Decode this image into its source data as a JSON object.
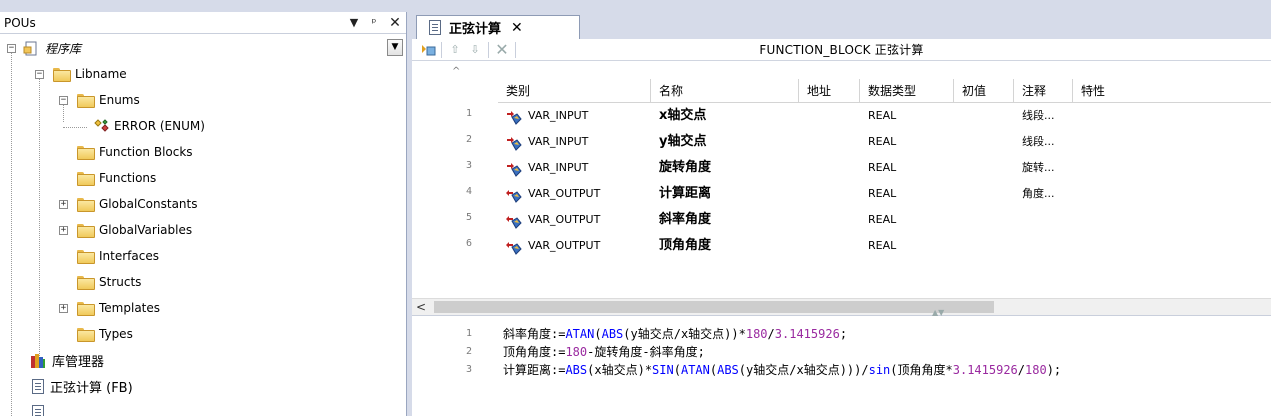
{
  "pou_panel": {
    "title": "POUs",
    "pin_glyph": "▾",
    "dock_glyph": "ꟷ",
    "close_glyph": "✕",
    "tree": [
      {
        "label": "程序库",
        "italic": true,
        "icon": "project-icon"
      },
      {
        "label": "Libname",
        "icon": "folder-icon"
      },
      {
        "label": "Enums",
        "icon": "folder-icon"
      },
      {
        "label": "ERROR (ENUM)",
        "icon": "enum-icon"
      },
      {
        "label": "Function Blocks",
        "icon": "folder-icon"
      },
      {
        "label": "Functions",
        "icon": "folder-icon"
      },
      {
        "label": "GlobalConstants",
        "icon": "folder-icon"
      },
      {
        "label": "GlobalVariables",
        "icon": "folder-icon"
      },
      {
        "label": "Interfaces",
        "icon": "folder-icon"
      },
      {
        "label": "Structs",
        "icon": "folder-icon"
      },
      {
        "label": "Templates",
        "icon": "folder-icon"
      },
      {
        "label": "Types",
        "icon": "folder-icon"
      },
      {
        "label": "库管理器",
        "icon": "library-manager-icon"
      },
      {
        "label": "正弦计算 (FB)",
        "icon": "document-icon"
      },
      {
        "label": "",
        "icon": "document-icon"
      }
    ]
  },
  "editor": {
    "tab_label": "正弦计算",
    "tab_close": "✕",
    "header": "FUNCTION_BLOCK 正弦计算",
    "columns": [
      "类别",
      "名称",
      "地址",
      "数据类型",
      "初值",
      "注释",
      "特性"
    ],
    "rows": [
      {
        "num": "1",
        "category": "VAR_INPUT",
        "name": "x轴交点",
        "address": "",
        "type": "REAL",
        "init": "",
        "comment": "线段...",
        "attr": "",
        "kind": "input"
      },
      {
        "num": "2",
        "category": "VAR_INPUT",
        "name": "y轴交点",
        "address": "",
        "type": "REAL",
        "init": "",
        "comment": "线段...",
        "attr": "",
        "kind": "input"
      },
      {
        "num": "3",
        "category": "VAR_INPUT",
        "name": "旋转角度",
        "address": "",
        "type": "REAL",
        "init": "",
        "comment": "旋转...",
        "attr": "",
        "kind": "input"
      },
      {
        "num": "4",
        "category": "VAR_OUTPUT",
        "name": "计算距离",
        "address": "",
        "type": "REAL",
        "init": "",
        "comment": "角度...",
        "attr": "",
        "kind": "output"
      },
      {
        "num": "5",
        "category": "VAR_OUTPUT",
        "name": "斜率角度",
        "address": "",
        "type": "REAL",
        "init": "",
        "comment": "",
        "attr": "",
        "kind": "output"
      },
      {
        "num": "6",
        "category": "VAR_OUTPUT",
        "name": "顶角角度",
        "address": "",
        "type": "REAL",
        "init": "",
        "comment": "",
        "attr": "",
        "kind": "output"
      }
    ],
    "code": [
      {
        "num": "1",
        "segments": [
          {
            "t": "斜率角度:=",
            "c": "txt"
          },
          {
            "t": "ATAN",
            "c": "kw"
          },
          {
            "t": "(",
            "c": "txt"
          },
          {
            "t": "ABS",
            "c": "kw"
          },
          {
            "t": "(y轴交点/x轴交点))*",
            "c": "txt"
          },
          {
            "t": "180",
            "c": "num"
          },
          {
            "t": "/",
            "c": "txt"
          },
          {
            "t": "3.1415926",
            "c": "num"
          },
          {
            "t": ";",
            "c": "txt"
          }
        ]
      },
      {
        "num": "2",
        "segments": [
          {
            "t": "顶角角度:=",
            "c": "txt"
          },
          {
            "t": "180",
            "c": "num"
          },
          {
            "t": "-旋转角度-斜率角度;",
            "c": "txt"
          }
        ]
      },
      {
        "num": "3",
        "segments": [
          {
            "t": "计算距离:=",
            "c": "txt"
          },
          {
            "t": "ABS",
            "c": "kw"
          },
          {
            "t": "(x轴交点)*",
            "c": "txt"
          },
          {
            "t": "SIN",
            "c": "kw"
          },
          {
            "t": "(",
            "c": "txt"
          },
          {
            "t": "ATAN",
            "c": "kw"
          },
          {
            "t": "(",
            "c": "txt"
          },
          {
            "t": "ABS",
            "c": "kw"
          },
          {
            "t": "(y轴交点/x轴交点)))/",
            "c": "txt"
          },
          {
            "t": "sin",
            "c": "kw"
          },
          {
            "t": "(顶角角度*",
            "c": "txt"
          },
          {
            "t": "3.1415926",
            "c": "num"
          },
          {
            "t": "/",
            "c": "txt"
          },
          {
            "t": "180",
            "c": "num"
          },
          {
            "t": ");",
            "c": "txt"
          }
        ]
      }
    ]
  },
  "colors": {
    "keyword": "#0000ff",
    "number": "#9a2aa0",
    "chrome": "#d6dbe9"
  }
}
